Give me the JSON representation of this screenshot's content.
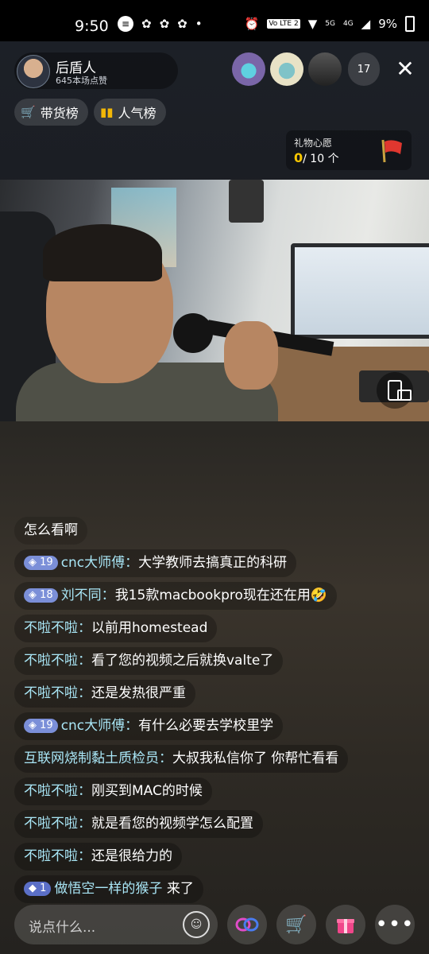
{
  "status_bar": {
    "time": "9:50",
    "volte": "Vo LTE 2",
    "net1": "5G",
    "net2": "4G",
    "battery": "9%"
  },
  "streamer": {
    "name": "后盾人",
    "likes": "645本场点赞"
  },
  "viewers": {
    "count": "17"
  },
  "tags": {
    "shopping_rank": "带货榜",
    "popularity_rank": "人气榜"
  },
  "gift_wish": {
    "title": "礼物心愿",
    "current": "0",
    "total": "/ 10 个"
  },
  "chat": [
    {
      "user": "",
      "level": "",
      "text": "怎么看啊"
    },
    {
      "user": "cnc大师傅：",
      "level": "19",
      "text": "大学教师去搞真正的科研"
    },
    {
      "user": "刘不同：",
      "level": "18",
      "text": "我15款macbookpro现在还在用🤣"
    },
    {
      "user": "不啦不啦：",
      "level": "",
      "text": "以前用homestead"
    },
    {
      "user": "不啦不啦：",
      "level": "",
      "text": "看了您的视频之后就换valte了"
    },
    {
      "user": "不啦不啦：",
      "level": "",
      "text": "还是发热很严重"
    },
    {
      "user": "cnc大师傅：",
      "level": "19",
      "text": "有什么必要去学校里学"
    },
    {
      "user": "互联网烧制黏土质检员：",
      "level": "",
      "text": "大叔我私信你了 你帮忙看看"
    },
    {
      "user": "不啦不啦：",
      "level": "",
      "text": "刚买到MAC的时候"
    },
    {
      "user": "不啦不啦：",
      "level": "",
      "text": "就是看您的视频学怎么配置"
    },
    {
      "user": "不啦不啦：",
      "level": "",
      "text": "还是很给力的"
    },
    {
      "user": "做悟空一样的猴子",
      "level": "1",
      "text": " 来了"
    }
  ],
  "bottom_bar": {
    "placeholder": "说点什么..."
  },
  "icons": [
    "chat-icon",
    "wechat-icon",
    "alarm-icon",
    "wifi-icon",
    "signal-icon",
    "battery-icon",
    "cart-icon",
    "bar-chart-icon",
    "flag-icon",
    "rotate-screen-icon",
    "emoji-icon",
    "link-icon",
    "shopping-cart-icon",
    "gift-icon",
    "more-icon"
  ],
  "colors": {
    "username": "#a9e6f6",
    "gold": "#f7c600",
    "level_badge": "#7b8fd8"
  }
}
